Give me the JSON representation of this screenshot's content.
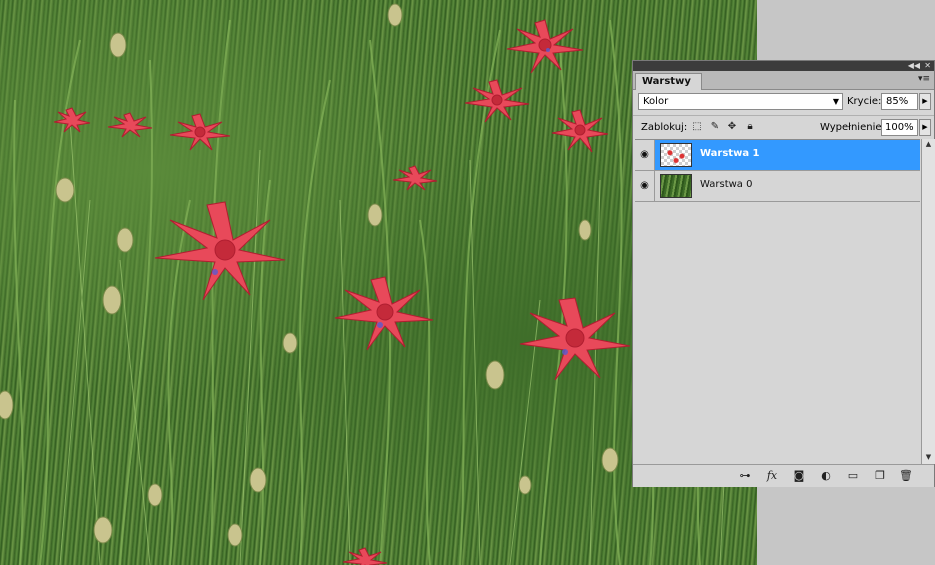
{
  "canvas": {
    "description_icon": "photo-canvas"
  },
  "panel": {
    "tab_label": "Warstwy",
    "blend_mode": "Kolor",
    "opacity_label": "Krycie:",
    "opacity_value": "85%",
    "lock_label": "Zablokuj:",
    "fill_label": "Wypełnienie:",
    "fill_value": "100%",
    "layers": [
      {
        "name": "Warstwa 1",
        "selected": true,
        "visible": true
      },
      {
        "name": "Warstwa 0",
        "selected": false,
        "visible": true
      }
    ],
    "icons": {
      "top": [
        "collapse-icon",
        "close-icon"
      ],
      "lock": [
        "lock-transparent-icon",
        "lock-image-icon",
        "lock-position-icon",
        "lock-all-icon"
      ],
      "bottom": [
        "link-layers-icon",
        "fx-icon",
        "add-mask-icon",
        "adjustment-layer-icon",
        "new-group-icon",
        "new-layer-icon",
        "trash-icon"
      ]
    }
  },
  "colors": {
    "selection": "#3399ff",
    "panel_bg": "#d6d6d6",
    "workspace": "#c6c6c6"
  }
}
